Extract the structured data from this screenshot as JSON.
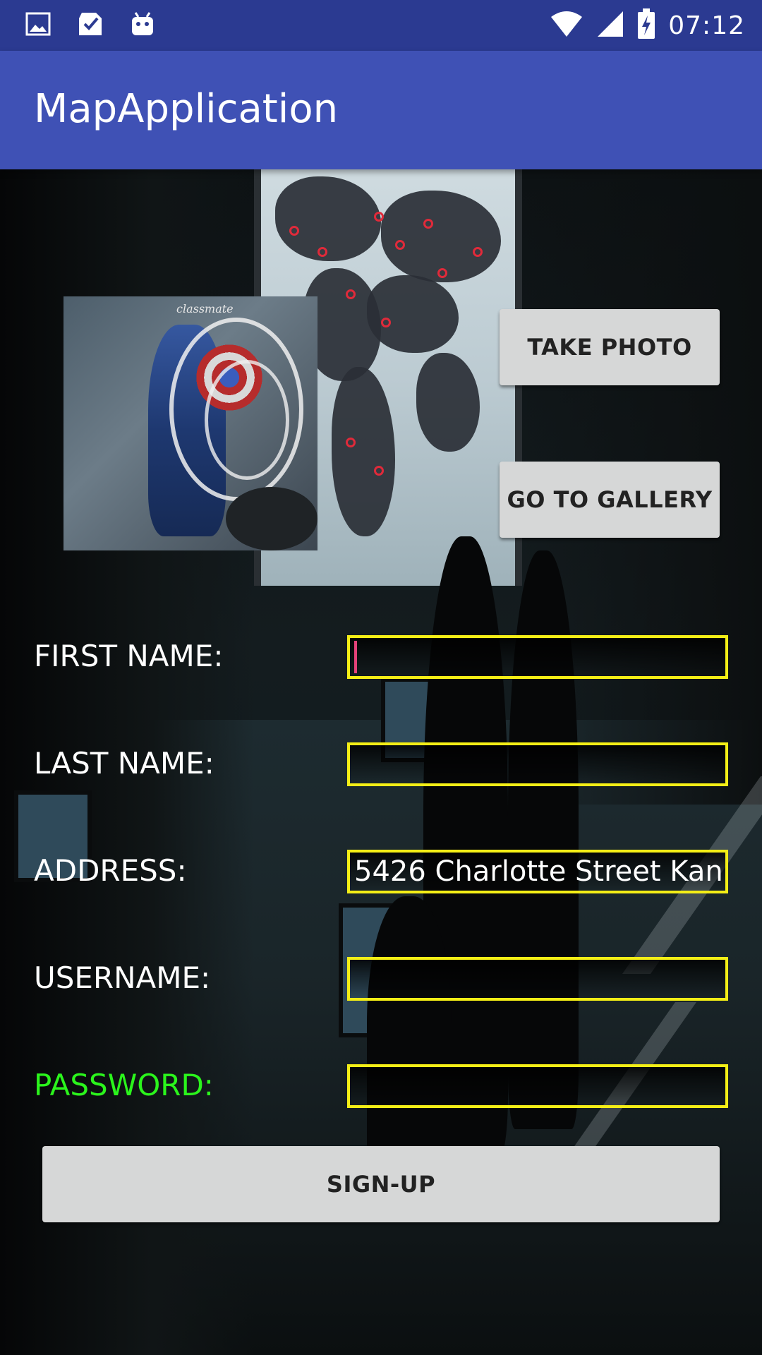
{
  "status_bar": {
    "time": "07:12",
    "left_icons": [
      "image-icon",
      "sd-card-check-icon",
      "android-icon"
    ],
    "right_icons": [
      "wifi-icon",
      "cell-signal-icon",
      "battery-charging-icon"
    ]
  },
  "app_bar": {
    "title": "MapApplication"
  },
  "buttons": {
    "take_photo": "TAKE PHOTO",
    "go_to_gallery": "GO TO GALLERY",
    "sign_up": "SIGN-UP"
  },
  "form": {
    "first_name": {
      "label": "FIRST NAME:",
      "value": ""
    },
    "last_name": {
      "label": "LAST NAME:",
      "value": ""
    },
    "address": {
      "label": "ADDRESS:",
      "value": "5426 Charlotte Street Kan"
    },
    "username": {
      "label": "USERNAME:",
      "value": ""
    },
    "password": {
      "label": "PASSWORD:",
      "value": ""
    }
  },
  "photo": {
    "caption": "classmate"
  },
  "colors": {
    "status_bar": "#2b3a91",
    "app_bar": "#3f51b5",
    "input_border": "#f4ee16",
    "password_label": "#2bf51c",
    "caret": "#e5417a",
    "button_bg": "#d6d7d7"
  }
}
